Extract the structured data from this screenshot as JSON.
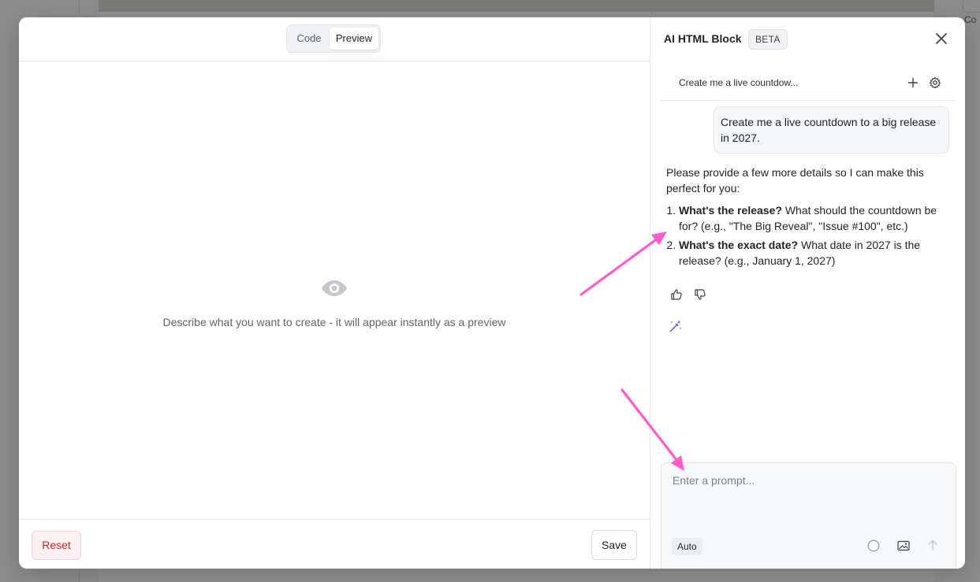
{
  "background": {
    "right_peek_text": "Co"
  },
  "modal": {
    "view_tabs": [
      {
        "label": "Code",
        "active": false
      },
      {
        "label": "Preview",
        "active": true
      }
    ],
    "preview": {
      "empty_icon": "eye-icon",
      "empty_text": "Describe what you want to create - it will appear instantly as a preview"
    },
    "footer": {
      "reset_label": "Reset",
      "save_label": "Save"
    }
  },
  "panel": {
    "title": "AI HTML Block",
    "badge": "BETA",
    "thread": {
      "title": "Create me a live countdow..."
    },
    "messages": {
      "user": "Create me a live countdown to a big release in 2027.",
      "assistant_intro": "Please provide a few more details so I can make this perfect for you:",
      "items": [
        {
          "bold": "What's the release?",
          "text": " What should the countdown be for? (e.g., \"The Big Reveal\", \"Issue #100\", etc.)"
        },
        {
          "bold": "What's the exact date?",
          "text": " What date in 2027 is the release? (e.g., January 1, 2027)"
        }
      ]
    },
    "composer": {
      "placeholder": "Enter a prompt...",
      "value": "",
      "mode_label": "Auto"
    }
  },
  "colors": {
    "annotation_arrow": "#ff5cc9",
    "reset_text": "#c0262d",
    "wand_icon": "#7c4dff"
  }
}
